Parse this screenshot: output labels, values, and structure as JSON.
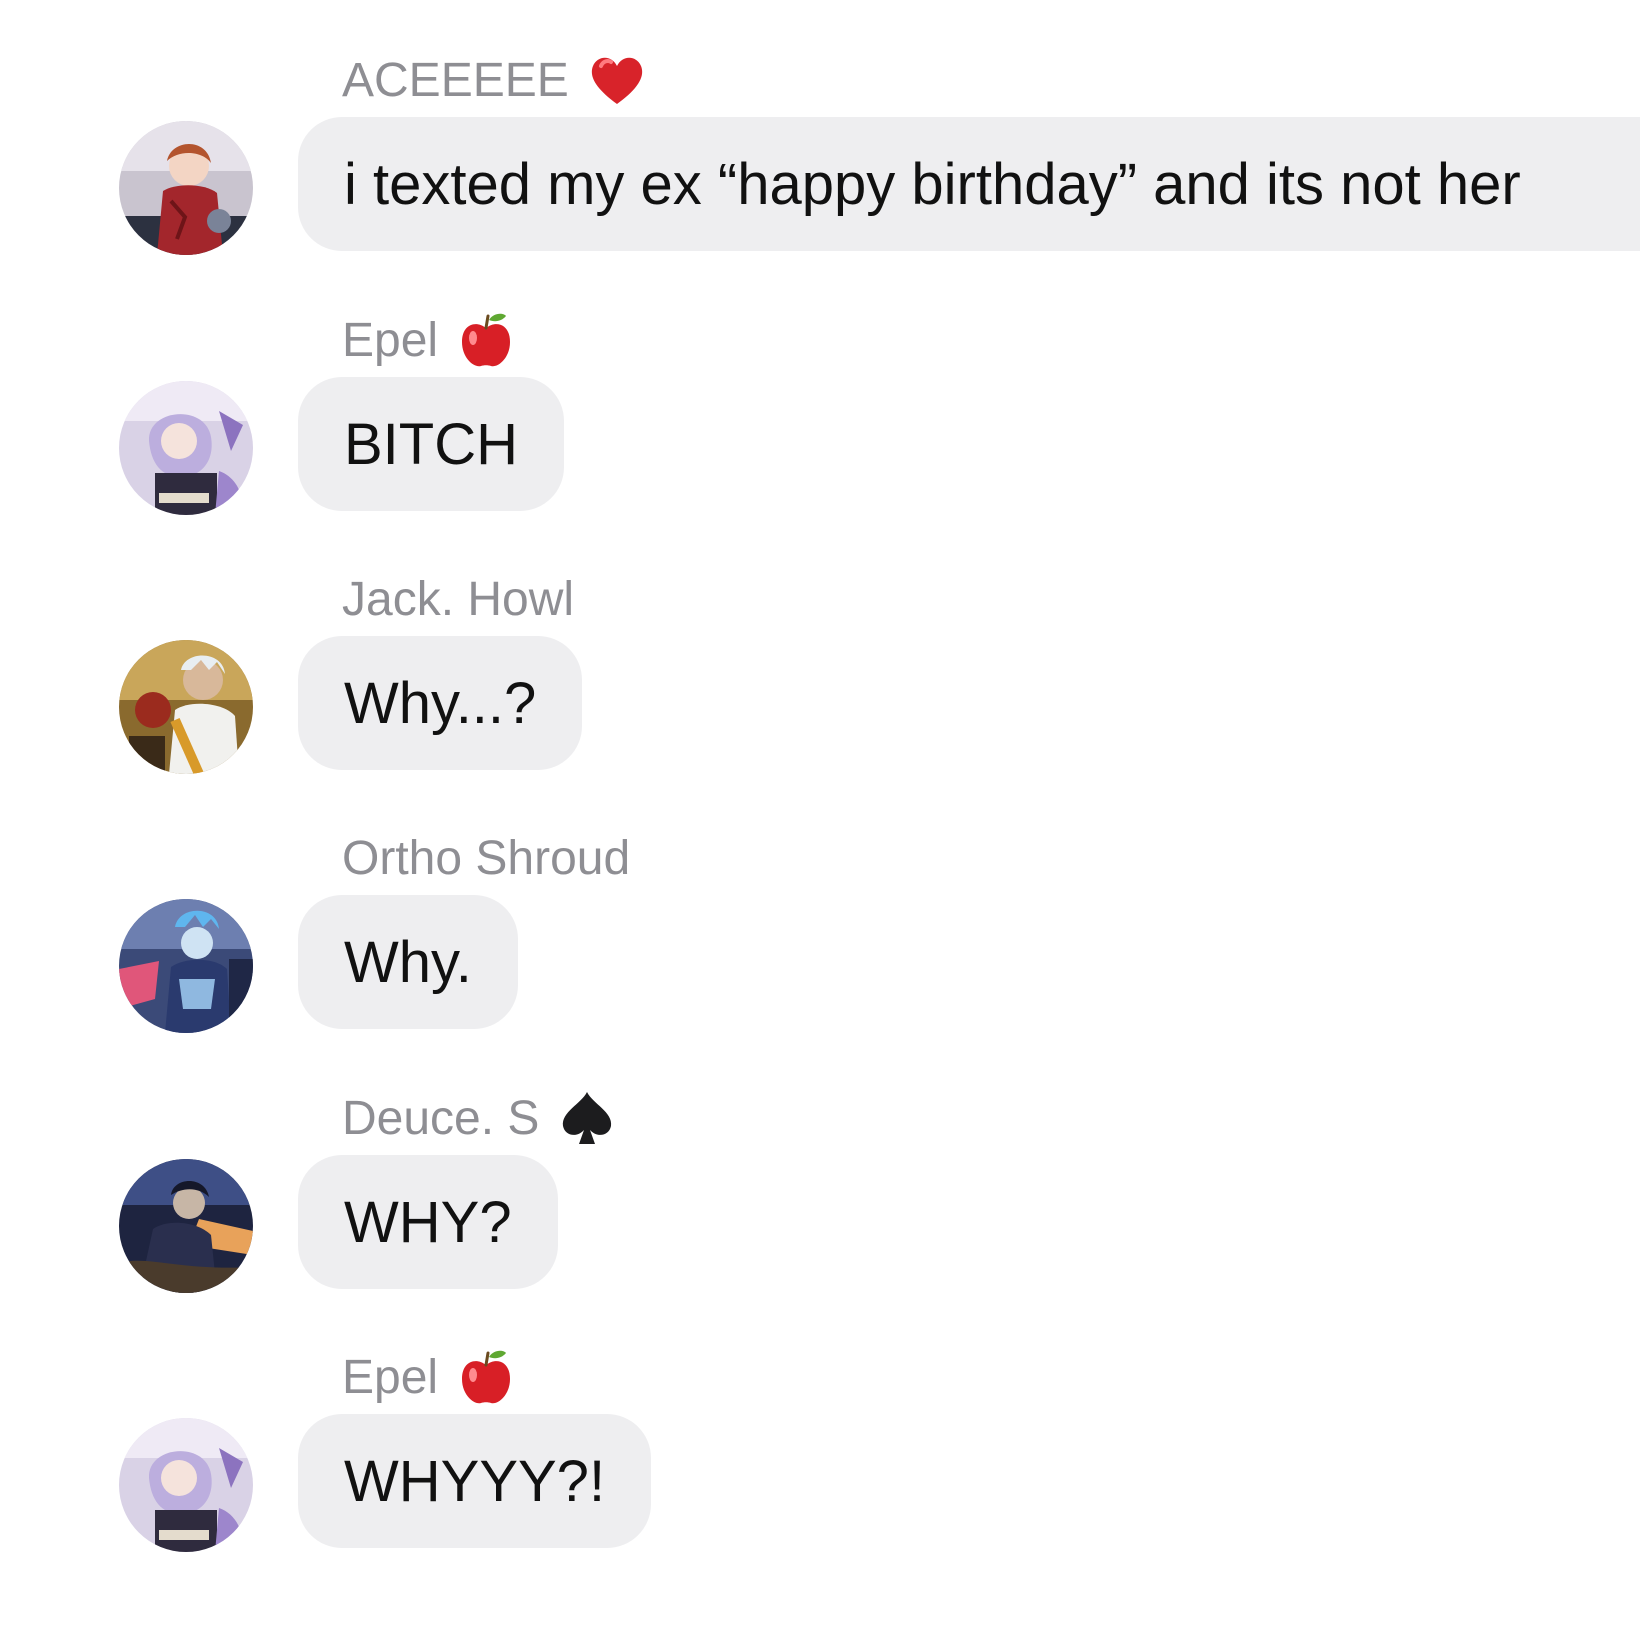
{
  "messages": [
    {
      "sender": "ACEEEEE",
      "sender_emoji": "heart-icon",
      "text": "i texted my ex “happy birthday” and its not her",
      "avatar": "avatar-ace"
    },
    {
      "sender": "Epel",
      "sender_emoji": "apple-icon",
      "text": "BITCH",
      "avatar": "avatar-epel"
    },
    {
      "sender": "Jack. Howl",
      "sender_emoji": "",
      "text": "Why...?",
      "avatar": "avatar-jack"
    },
    {
      "sender": "Ortho Shroud",
      "sender_emoji": "",
      "text": "Why.",
      "avatar": "avatar-ortho"
    },
    {
      "sender": "Deuce. S",
      "sender_emoji": "spade-icon",
      "text": "WHY?",
      "avatar": "avatar-deuce"
    },
    {
      "sender": "Epel",
      "sender_emoji": "apple-icon",
      "text": "WHYYY?!",
      "avatar": "avatar-epel"
    }
  ],
  "colors": {
    "bubble_background": "#eeeef0",
    "sender_name": "#8e8e93",
    "message_text": "#111111",
    "heart": "#d8232a",
    "apple": "#d81f26",
    "spade": "#1c1c1e"
  }
}
